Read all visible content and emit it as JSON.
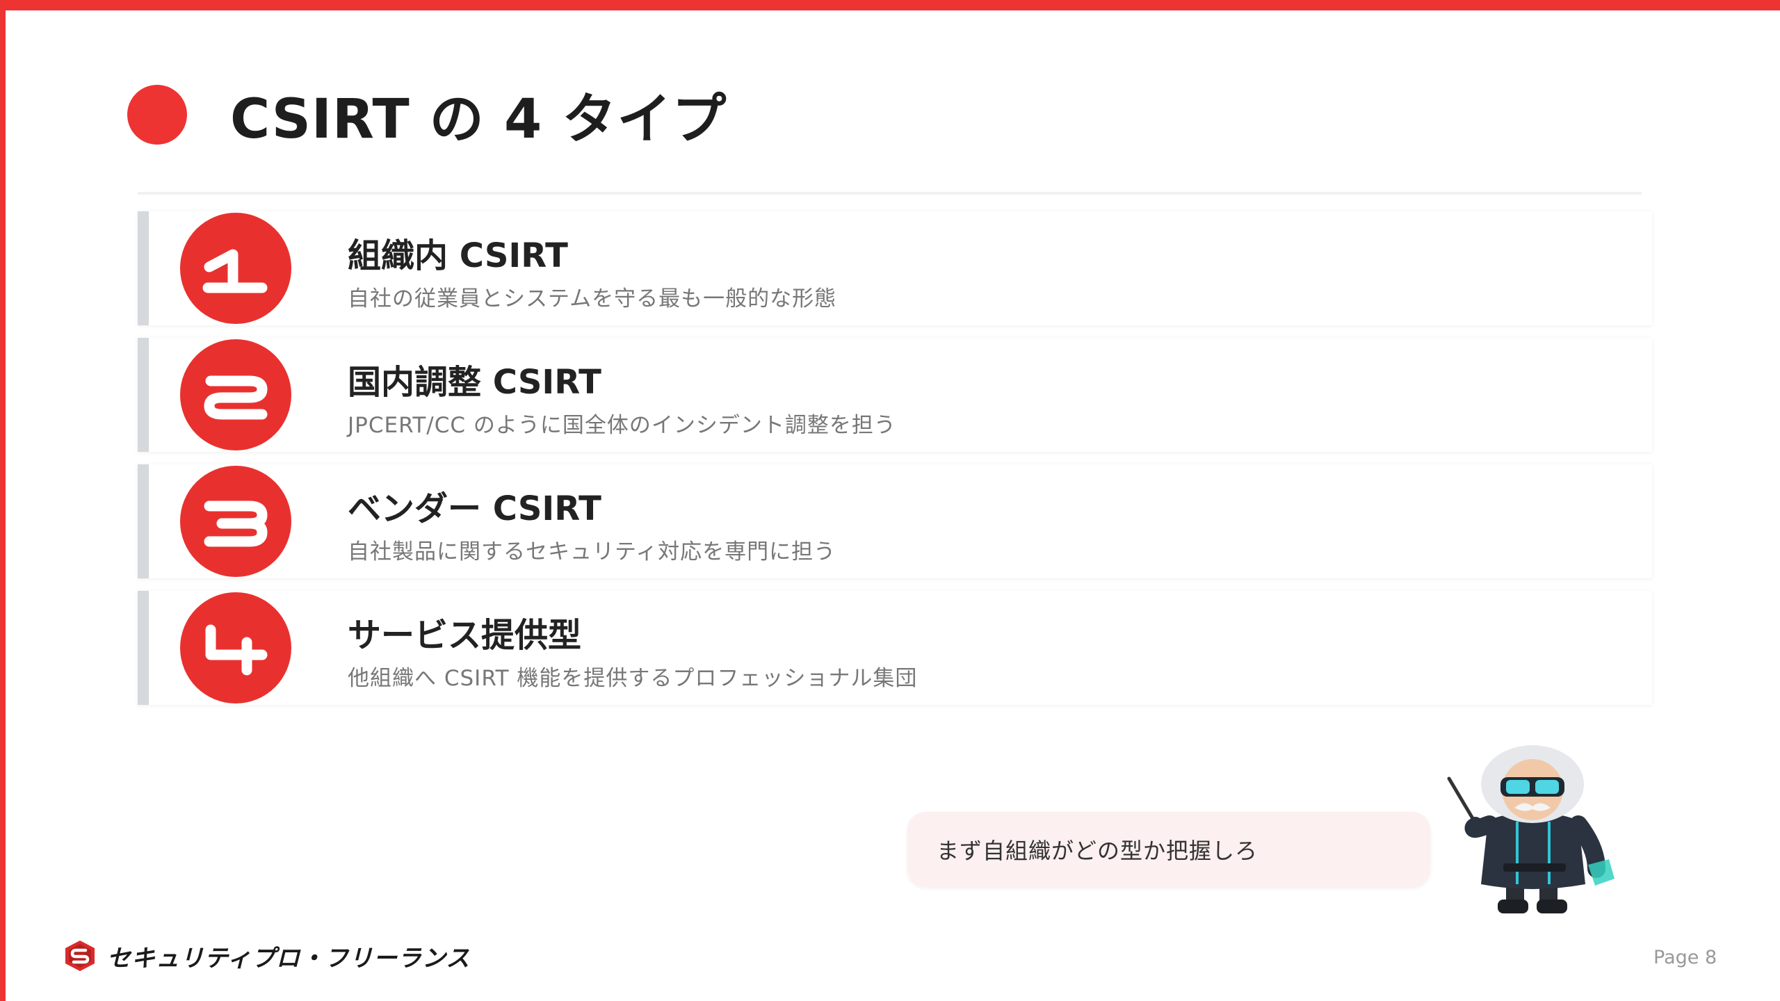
{
  "slide": {
    "title": "CSIRT の 4 タイプ",
    "accent_color": "#ee3333",
    "badge_color": "#e8312f"
  },
  "cards": [
    {
      "number": "1",
      "title": "組織内 CSIRT",
      "description": "自社の従業員とシステムを守る最も一般的な形態"
    },
    {
      "number": "2",
      "title": "国内調整 CSIRT",
      "description": "JPCERT/CC のように国全体のインシデント調整を担う"
    },
    {
      "number": "3",
      "title": "ベンダー CSIRT",
      "description": "自社製品に関するセキュリティ対応を専門に担う"
    },
    {
      "number": "4",
      "title": "サービス提供型",
      "description": "他組織へ CSIRT 機能を提供するプロフェッショナル集団"
    }
  ],
  "speech_bubble": {
    "text": "まず自組織がどの型か把握しろ"
  },
  "footer": {
    "logo_text": "セキュリティプロ・フリーランス",
    "logo_icon": "shield-s-logo-icon",
    "page_label": "Page 8"
  }
}
